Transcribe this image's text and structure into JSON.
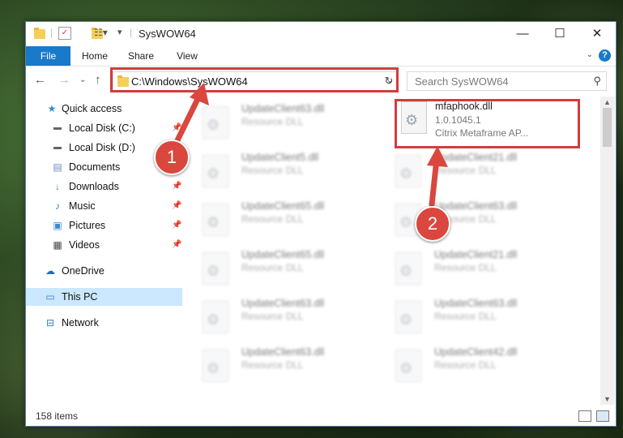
{
  "window": {
    "title": "SysWOW64",
    "controls": {
      "minimize": "—",
      "maximize": "☐",
      "close": "✕"
    }
  },
  "ribbon": {
    "tabs": [
      "File",
      "Home",
      "Share",
      "View"
    ],
    "help": "?"
  },
  "navigation": {
    "address": "C:\\Windows\\SysWOW64",
    "search_placeholder": "Search SysWOW64"
  },
  "sidebar": {
    "items": [
      {
        "label": "Quick access",
        "icon": "star-icon",
        "pinned": false
      },
      {
        "label": "Local Disk (C:)",
        "icon": "drive-icon",
        "pinned": true
      },
      {
        "label": "Local Disk (D:)",
        "icon": "drive-icon",
        "pinned": false
      },
      {
        "label": "Documents",
        "icon": "document-icon",
        "pinned": true
      },
      {
        "label": "Downloads",
        "icon": "download-icon",
        "pinned": true
      },
      {
        "label": "Music",
        "icon": "music-icon",
        "pinned": true
      },
      {
        "label": "Pictures",
        "icon": "picture-icon",
        "pinned": true
      },
      {
        "label": "Videos",
        "icon": "video-icon",
        "pinned": true
      },
      {
        "label": "OneDrive",
        "icon": "cloud-icon",
        "pinned": false
      },
      {
        "label": "This PC",
        "icon": "computer-icon",
        "pinned": false
      },
      {
        "label": "Network",
        "icon": "network-icon",
        "pinned": false
      }
    ]
  },
  "files": {
    "highlighted": {
      "name": "mfaphook.dll",
      "version": "1.0.1045.1",
      "description": "Citrix Metaframe AP..."
    },
    "blurred": [
      {
        "name": "UpdateClient63.dll",
        "type": "Resource DLL"
      },
      {
        "name": "UpdateClient5.dll",
        "type": "Resource DLL"
      },
      {
        "name": "UpdateClient21.dll",
        "type": "Resource DLL"
      },
      {
        "name": "UpdateClient65.dll",
        "type": "Resource DLL"
      },
      {
        "name": "UpdateClient63.dll",
        "type": "Resource DLL"
      },
      {
        "name": "UpdateClient65.dll",
        "type": "Resource DLL"
      },
      {
        "name": "UpdateClient21.dll",
        "type": "Resource DLL"
      },
      {
        "name": "UpdateClient63.dll",
        "type": "Resource DLL"
      },
      {
        "name": "UpdateClient63.dll",
        "type": "Resource DLL"
      },
      {
        "name": "UpdateClient63.dll",
        "type": "Resource DLL"
      },
      {
        "name": "UpdateClient42.dll",
        "type": "Resource DLL"
      }
    ]
  },
  "status": {
    "item_count": "158 items"
  },
  "callouts": [
    "1",
    "2"
  ],
  "colors": {
    "accent": "#1979ca",
    "annotation_red": "#d33c3c",
    "selection": "#cce8ff"
  }
}
